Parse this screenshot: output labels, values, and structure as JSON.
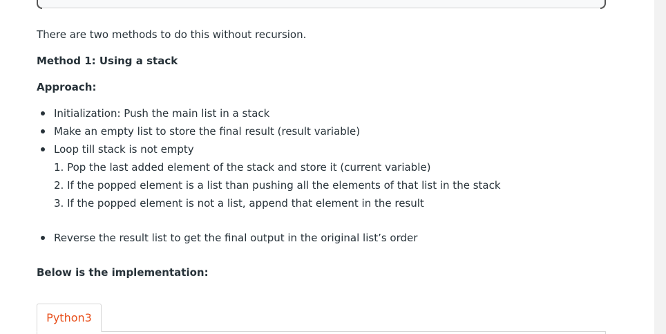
{
  "article": {
    "intro": "There are two methods to do this without recursion.",
    "method_heading": "Method 1: Using a stack",
    "approach_heading": "Approach:",
    "bullets": [
      "Initialization: Push the main list in a stack",
      "Make an empty list to store the final result (result variable)",
      "Loop till stack is not empty"
    ],
    "steps": [
      "1. Pop the last added element of the stack and store it (current variable)",
      "2. If the popped element is a list than pushing all the elements of that list in the stack",
      "3. If the popped element is not a list, append that element in the result"
    ],
    "final_bullet": "Reverse the result list to get the final output in the original list’s order",
    "implementation_heading": "Below is the implementation:"
  },
  "code_tabs": {
    "active_label": "Python3",
    "active_color": "#e8501c"
  },
  "colors": {
    "text": "#273239",
    "border": "#d5d5d5"
  }
}
